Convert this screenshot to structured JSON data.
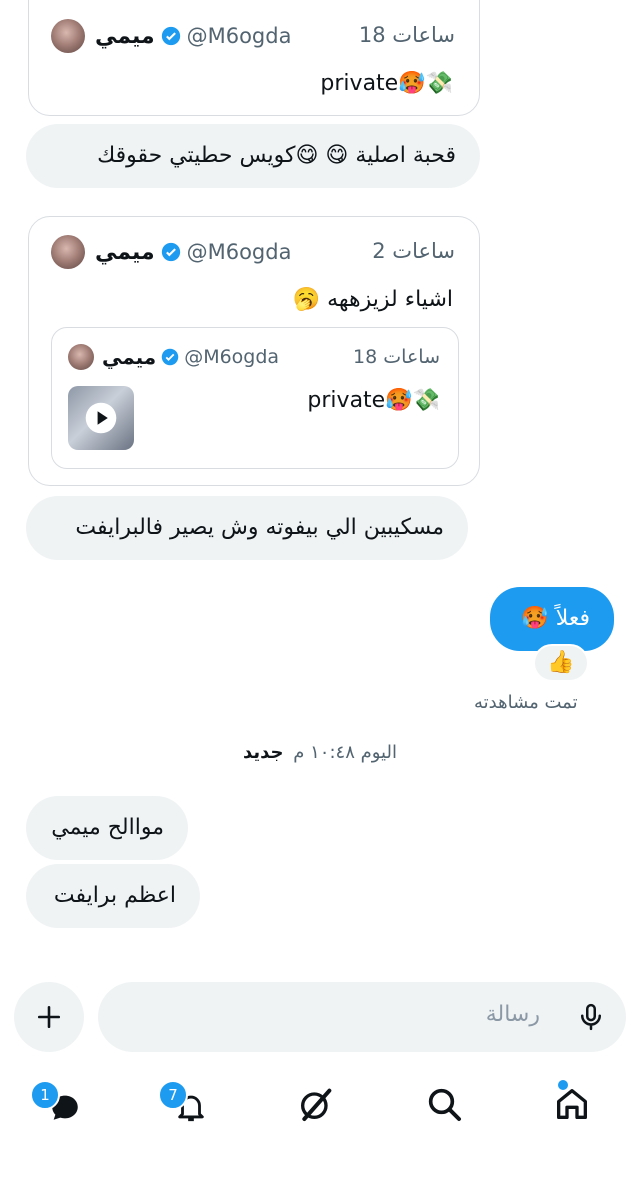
{
  "tweets": [
    {
      "name": "ميمي",
      "handle": "@M6ogda",
      "time": "18 ساعات",
      "text": "private🥵💸"
    },
    {
      "name": "ميمي",
      "handle": "@M6ogda",
      "time": "2 ساعات",
      "text": "اشياء لزيزههه 🥱",
      "quote": {
        "name": "ميمي",
        "handle": "@M6ogda",
        "time": "18 ساعات",
        "text": "private🥵💸",
        "media_label": "play-icon"
      }
    }
  ],
  "messages": {
    "m1": "قحبة اصلية 😋 😋كويس حطيتي حقوقك",
    "m2": "مسكيبين الي بيفوته وش يصير فالبرايفت",
    "sent": "فعلاً 🥵",
    "reaction": "👍",
    "seen": "تمت مشاهدته",
    "separator_time": "اليوم ١٠:٤٨ م",
    "separator_new": "جديد",
    "m3": "مواالح ميمي",
    "m4": "اعظم برايفت"
  },
  "composer": {
    "placeholder": "رسالة",
    "add_icon": "plus-icon",
    "mic_icon": "mic-icon"
  },
  "nav": {
    "items": [
      "messages-icon",
      "notifications-icon",
      "grok-icon",
      "search-icon",
      "home-icon"
    ],
    "badges": {
      "messages": "1",
      "notifications": "7"
    }
  },
  "colors": {
    "accent": "#1d9bf0",
    "bubble": "#eff3f4",
    "muted": "#536471"
  }
}
